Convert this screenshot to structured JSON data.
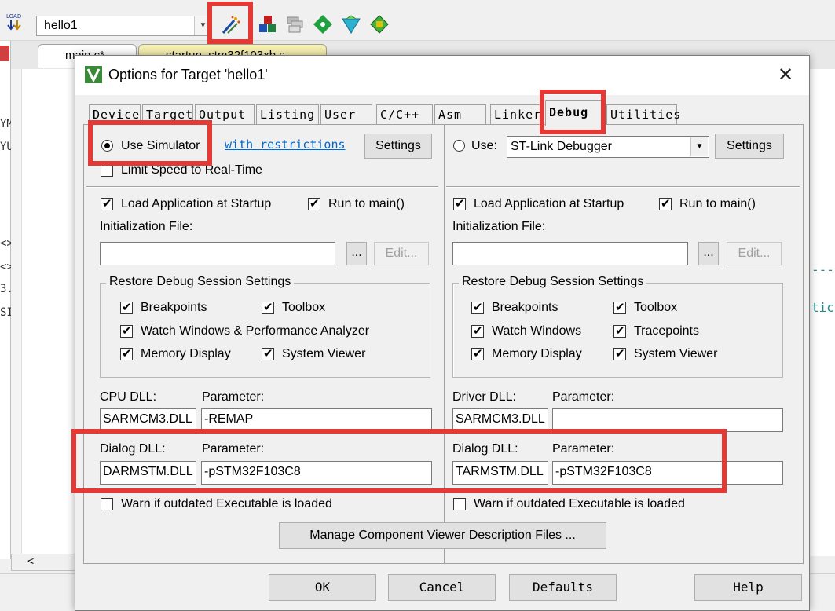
{
  "ide": {
    "target_combo_value": "hello1",
    "file_tabs": [
      {
        "label": "main.c*"
      },
      {
        "label": "startup_stm32f103xb.s"
      }
    ],
    "left_glyphs": [
      "YM",
      "YU",
      "<>",
      "<>",
      "3.",
      "SI:"
    ],
    "code_fragments": [
      "---",
      "tic"
    ]
  },
  "dialog": {
    "title": "Options for Target 'hello1'",
    "close_icon": "close-icon",
    "tabs": [
      "Device",
      "Target",
      "Output",
      "Listing",
      "User",
      "C/C++",
      "Asm",
      "Linker",
      "Debug",
      "Utilities"
    ],
    "active_tab": "Debug",
    "left": {
      "mode_label": "Use Simulator",
      "mode_selected": true,
      "restrictions_link": "with restrictions",
      "settings_label": "Settings",
      "limit_speed_label": "Limit Speed to Real-Time",
      "limit_speed_checked": false,
      "load_app_label": "Load Application at Startup",
      "load_app_checked": true,
      "run_to_main_label": "Run to main()",
      "run_to_main_checked": true,
      "init_file_label": "Initialization File:",
      "init_file_value": "",
      "browse_label": "...",
      "edit_label": "Edit...",
      "restore_group_title": "Restore Debug Session Settings",
      "restore_items": [
        {
          "label": "Breakpoints",
          "checked": true
        },
        {
          "label": "Toolbox",
          "checked": true
        },
        {
          "label": "Watch Windows & Performance Analyzer",
          "checked": true
        },
        {
          "label": "Memory Display",
          "checked": true
        },
        {
          "label": "System Viewer",
          "checked": true
        }
      ],
      "cpu_dll_label": "CPU DLL:",
      "cpu_param_label": "Parameter:",
      "cpu_dll_value": "SARMCM3.DLL",
      "cpu_param_value": "-REMAP",
      "dialog_dll_label": "Dialog DLL:",
      "dialog_param_label": "Parameter:",
      "dialog_dll_value": "DARMSTM.DLL",
      "dialog_param_value": "-pSTM32F103C8",
      "warn_label": "Warn if outdated Executable is loaded",
      "warn_checked": false
    },
    "right": {
      "mode_label": "Use:",
      "mode_selected": false,
      "debugger_value": "ST-Link Debugger",
      "settings_label": "Settings",
      "load_app_label": "Load Application at Startup",
      "load_app_checked": true,
      "run_to_main_label": "Run to main()",
      "run_to_main_checked": true,
      "init_file_label": "Initialization File:",
      "init_file_value": "",
      "browse_label": "...",
      "edit_label": "Edit...",
      "restore_group_title": "Restore Debug Session Settings",
      "restore_items": [
        {
          "label": "Breakpoints",
          "checked": true
        },
        {
          "label": "Toolbox",
          "checked": true
        },
        {
          "label": "Watch Windows",
          "checked": true
        },
        {
          "label": "Tracepoints",
          "checked": true
        },
        {
          "label": "Memory Display",
          "checked": true
        },
        {
          "label": "System Viewer",
          "checked": true
        }
      ],
      "driver_dll_label": "Driver DLL:",
      "driver_param_label": "Parameter:",
      "driver_dll_value": "SARMCM3.DLL",
      "driver_param_value": "",
      "dialog_dll_label": "Dialog DLL:",
      "dialog_param_label": "Parameter:",
      "dialog_dll_value": "TARMSTM.DLL",
      "dialog_param_value": "-pSTM32F103C8",
      "warn_label": "Warn if outdated Executable is loaded",
      "warn_checked": false
    },
    "manage_label": "Manage Component Viewer Description Files ...",
    "buttons": {
      "ok": "OK",
      "cancel": "Cancel",
      "defaults": "Defaults",
      "help": "Help"
    }
  },
  "colors": {
    "highlight": "#e53935",
    "link": "#0066cc"
  }
}
